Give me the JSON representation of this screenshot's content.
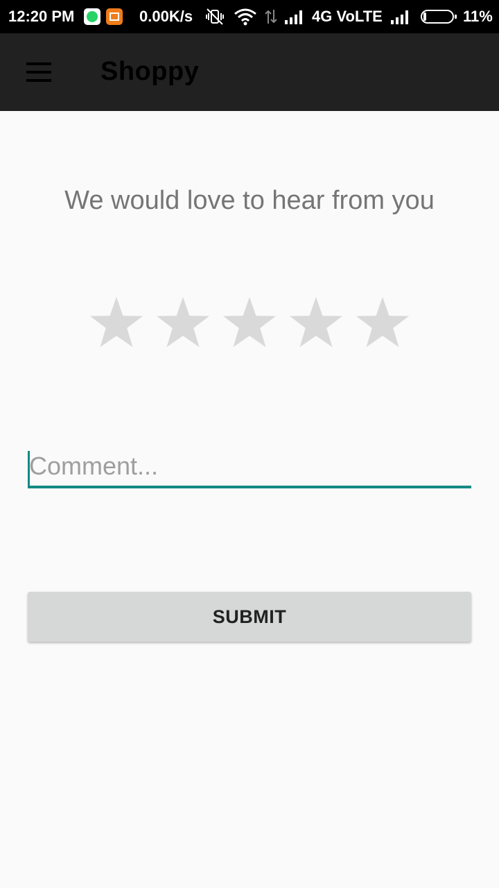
{
  "status_bar": {
    "time": "12:20 PM",
    "network_speed": "0.00K/s",
    "network_type": "4G VoLTE",
    "battery_percent": "11%",
    "battery_level": 0.11,
    "icons": [
      "whatsapp-icon",
      "news-app-icon",
      "vibrate-off-icon",
      "wifi-icon",
      "data-arrows-icon",
      "signal-icon",
      "signal-icon",
      "battery-icon"
    ]
  },
  "app_bar": {
    "title": "Shoppy",
    "menu_icon": "hamburger-menu-icon"
  },
  "feedback": {
    "headline": "We would love to hear from you",
    "rating": {
      "max_stars": 5,
      "selected": 0,
      "star_color": "#d9d9d9"
    },
    "comment": {
      "value": "",
      "placeholder": "Comment..."
    },
    "submit_label": "SUBMIT"
  },
  "colors": {
    "app_bar": "#212121",
    "accent": "#138a83",
    "background": "#fafafa",
    "button": "#d6d7d7"
  }
}
